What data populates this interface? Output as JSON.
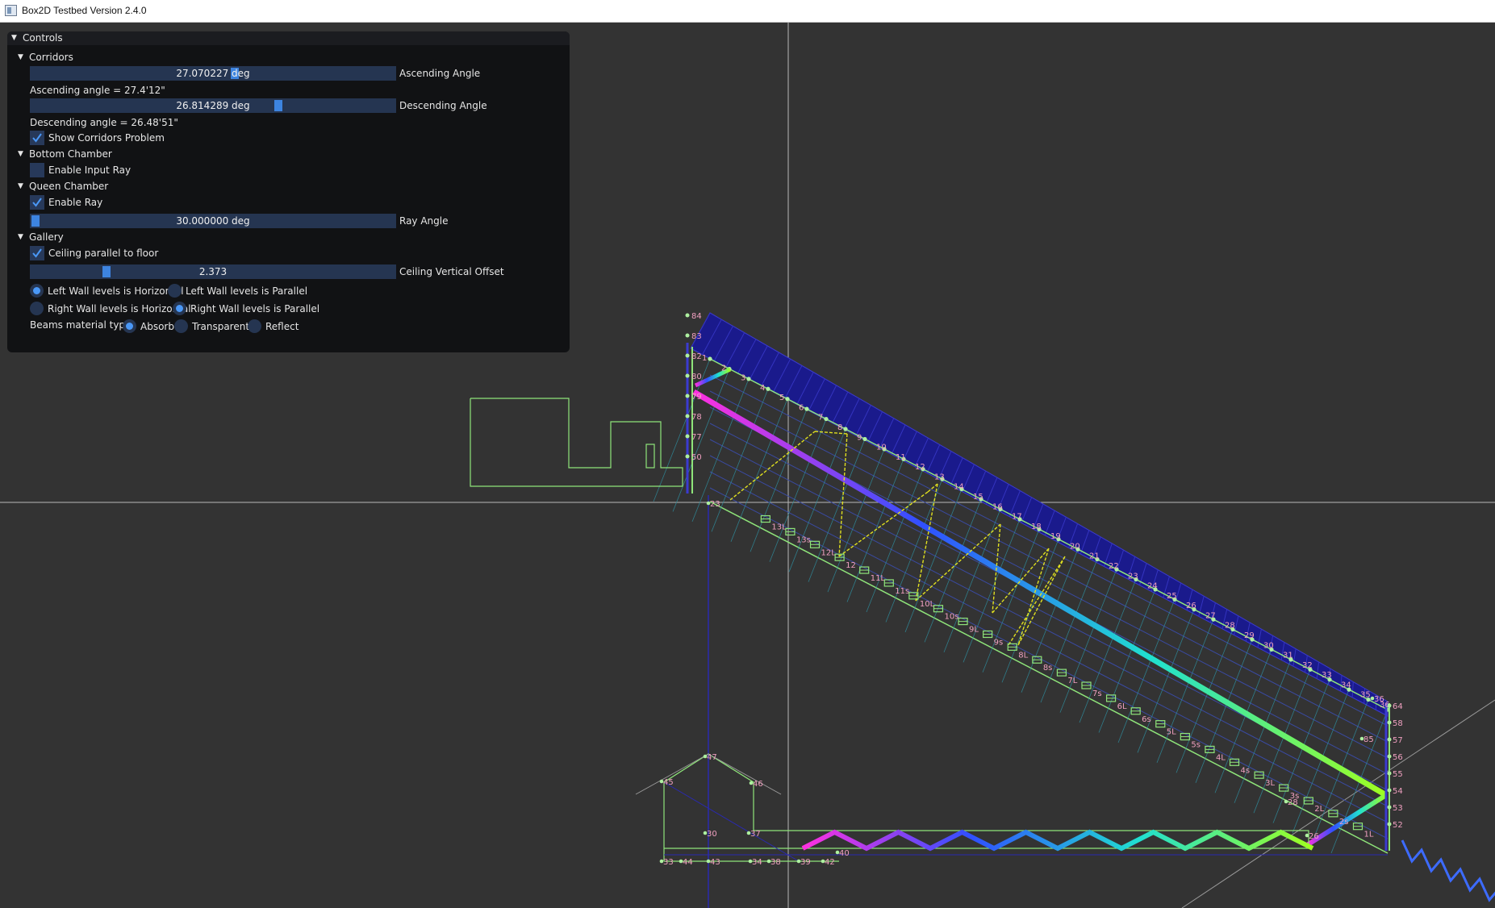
{
  "window": {
    "title": "Box2D Testbed Version 2.4.0",
    "background_color": "#333333"
  },
  "panel": {
    "title": "Controls",
    "sections": {
      "corridors": {
        "label": "Corridors",
        "ascending_slider": {
          "value_text": "27.070227 deg",
          "label": "Ascending Angle",
          "value": 27.070227
        },
        "ascending_info": "Ascending angle =  27.4'12\"",
        "descending_slider": {
          "value_text": "26.814289 deg",
          "label": "Descending Angle",
          "value": 26.814289
        },
        "descending_info": "Descending angle =  26.48'51\"",
        "show_problem": {
          "label": "Show Corridors Problem",
          "checked": true
        }
      },
      "bottom_chamber": {
        "label": "Bottom Chamber",
        "enable_input_ray": {
          "label": "Enable Input Ray",
          "checked": false
        }
      },
      "queen_chamber": {
        "label": "Queen Chamber",
        "enable_ray": {
          "label": "Enable Ray",
          "checked": true
        },
        "ray_slider": {
          "value_text": "30.000000 deg",
          "label": "Ray Angle",
          "value": 30.0
        }
      },
      "gallery": {
        "label": "Gallery",
        "ceiling_parallel": {
          "label": "Ceiling parallel to floor",
          "checked": true
        },
        "offset_slider": {
          "value_text": "2.373",
          "label": "Ceiling Vertical Offset",
          "value": 2.373
        },
        "left_wall": {
          "horizontal": "Left Wall levels is Horizontal",
          "parallel": "Left Wall levels is Parallel",
          "selected": "horizontal"
        },
        "right_wall": {
          "horizontal": "Right Wall levels is Horizontal",
          "parallel": "Right Wall levels is Parallel",
          "selected": "parallel"
        },
        "beams": {
          "label": "Beams material type:",
          "absorb": "Absorb",
          "transparent": "Transparent",
          "reflect": "Reflect",
          "selected": "absorb"
        }
      }
    }
  },
  "colors": {
    "body_outline": "#8fe57a",
    "vertex": "#aef0a0",
    "label": "#f0a0c0",
    "ceiling_fill": "#1a1a8c",
    "ray": "#e0e020",
    "accent": "#4a98f7"
  },
  "scene": {
    "top_labels": [
      "1",
      "2",
      "3",
      "4",
      "5",
      "6",
      "7",
      "8",
      "9",
      "10",
      "11",
      "12",
      "13",
      "14",
      "15",
      "16",
      "17",
      "18",
      "19",
      "20",
      "21",
      "22",
      "23",
      "24",
      "25",
      "26",
      "27",
      "28",
      "29",
      "30",
      "31",
      "32",
      "33",
      "34",
      "35",
      "36"
    ],
    "step_labels": [
      "13L",
      "13s",
      "12L",
      "12",
      "11L",
      "11s",
      "10L",
      "10s",
      "9L",
      "9s",
      "8L",
      "8s",
      "7L",
      "7s",
      "6L",
      "6s",
      "5L",
      "5s",
      "4L",
      "4s",
      "3L",
      "3s",
      "2L",
      "2s",
      "1L"
    ],
    "left_wall_labels": [
      "84",
      "83",
      "82",
      "80",
      "79",
      "78",
      "77",
      "50"
    ],
    "right_wall_labels": [
      "64",
      "58",
      "57",
      "56",
      "55",
      "54",
      "53",
      "52"
    ],
    "bottom_labels": [
      "23",
      "45",
      "46",
      "47",
      "30",
      "37",
      "33",
      "44",
      "43",
      "34",
      "38",
      "39",
      "42",
      "40",
      "26",
      "28",
      "85",
      "36"
    ]
  }
}
